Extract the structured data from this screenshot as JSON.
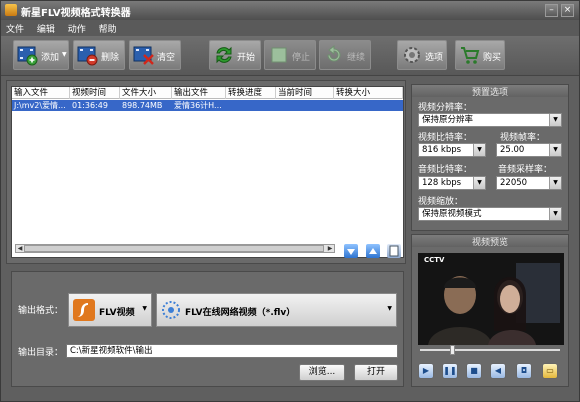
{
  "window": {
    "title": "新星FLV视频格式转换器",
    "minimize": "–",
    "close": "×"
  },
  "menu": [
    "文件",
    "编辑",
    "动作",
    "帮助"
  ],
  "toolbar": {
    "add": "添加",
    "delete": "删除",
    "clear": "清空",
    "start": "开始",
    "stop": "停止",
    "continue": "继续",
    "options": "选项",
    "buy": "购买"
  },
  "table": {
    "columns": [
      "输入文件",
      "视频时间",
      "文件大小",
      "输出文件",
      "转换进度",
      "当前时间",
      "转换大小"
    ],
    "rows": [
      [
        "J:\\mv2\\爱情...",
        "01:36:49",
        "898.74MB",
        "爱情36计H...",
        "",
        "",
        ""
      ]
    ]
  },
  "presets": {
    "title": "预置选项",
    "resolution_label": "视频分辨率：",
    "resolution_value": "保持原分辨率",
    "vbitrate_label": "视频比特率：",
    "vbitrate_value": "816 kbps",
    "framerate_label": "视频帧率：",
    "framerate_value": "25.00",
    "abitrate_label": "音频比特率：",
    "abitrate_value": "128 kbps",
    "samplerate_label": "音频采样率：",
    "samplerate_value": "22050",
    "scale_label": "视频缩放：",
    "scale_value": "保持原视频模式"
  },
  "preview": {
    "title": "视频预览",
    "channel_logo": "CCTV",
    "playback_position": 0.22
  },
  "output": {
    "format_label": "输出格式：",
    "format_type": "FLV视频",
    "format_detail": "FLV在线网络视频（*.flv）",
    "dir_label": "输出目录：",
    "dir_value": "C:\\新星视频软件\\输出",
    "browse": "浏览...",
    "open": "打开"
  }
}
